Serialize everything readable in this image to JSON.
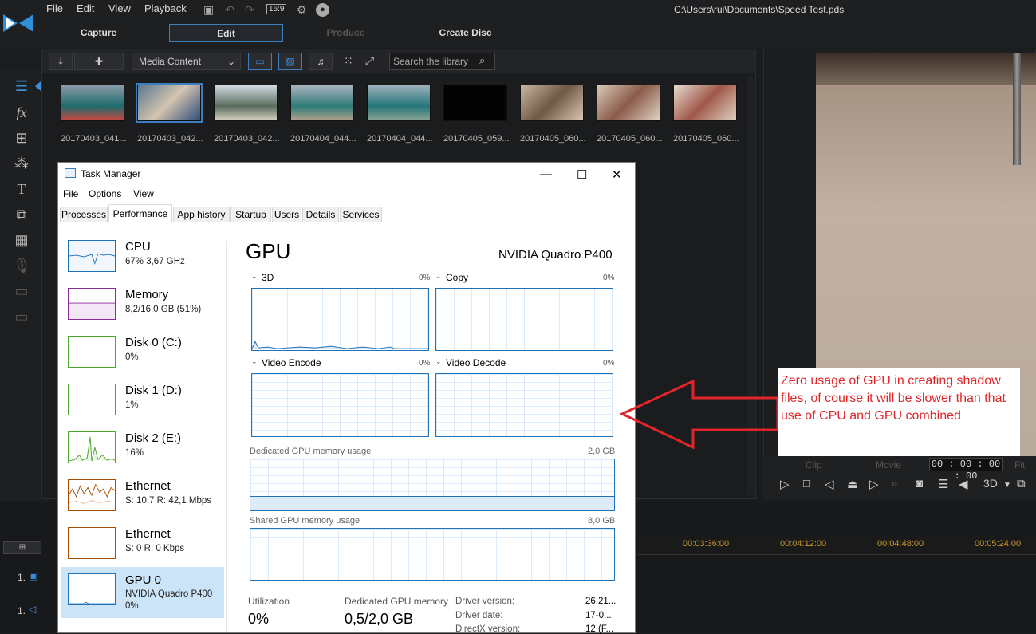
{
  "app": {
    "menu": [
      "File",
      "Edit",
      "View",
      "Playback"
    ],
    "aspect": "16:9",
    "file_path": "C:\\Users\\rui\\Documents\\Speed Test.pds",
    "modes": [
      "Capture",
      "Edit",
      "Produce",
      "Create Disc"
    ]
  },
  "library": {
    "media_select": "Media Content",
    "search_placeholder": "Search the library",
    "thumbs": [
      "20170403_041...",
      "20170403_042...",
      "20170403_042...",
      "20170404_044...",
      "20170404_044...",
      "20170405_059...",
      "20170405_060...",
      "20170405_060...",
      "20170405_060..."
    ]
  },
  "preview": {
    "clip": "Clip",
    "movie": "Movie",
    "timecode": "00 : 00 : 00 : 00",
    "fit": "Fit",
    "mode3d": "3D"
  },
  "timeline": {
    "ticks": [
      "00:03:36:00",
      "00:04:12:00",
      "00:04:48:00",
      "00:05:24:00"
    ],
    "tracks": [
      "1.",
      "1."
    ]
  },
  "taskmanager": {
    "title": "Task Manager",
    "menu": [
      "File",
      "Options",
      "View"
    ],
    "tabs": [
      "Processes",
      "Performance",
      "App history",
      "Startup",
      "Users",
      "Details",
      "Services"
    ],
    "sidebar": [
      {
        "name": "CPU",
        "sub": "67% 3,67 GHz",
        "color": "#1e73b8"
      },
      {
        "name": "Memory",
        "sub": "8,2/16,0 GB (51%)",
        "color": "#8b2a99"
      },
      {
        "name": "Disk 0 (C:)",
        "sub": "0%",
        "color": "#4da62e"
      },
      {
        "name": "Disk 1 (D:)",
        "sub": "1%",
        "color": "#4da62e"
      },
      {
        "name": "Disk 2 (E:)",
        "sub": "16%",
        "color": "#4da62e"
      },
      {
        "name": "Ethernet",
        "sub": "S: 10,7  R: 42,1 Mbps",
        "color": "#a74f01"
      },
      {
        "name": "Ethernet",
        "sub": "S: 0  R: 0 Kbps",
        "color": "#a74f01"
      },
      {
        "name": "GPU 0",
        "sub": "NVIDIA Quadro P400",
        "sub2": "0%",
        "color": "#1e73b8"
      }
    ],
    "gpu": {
      "heading": "GPU",
      "model": "NVIDIA Quadro P400",
      "engines": [
        {
          "name": "3D",
          "pct": "0%"
        },
        {
          "name": "Copy",
          "pct": "0%"
        },
        {
          "name": "Video Encode",
          "pct": "0%"
        },
        {
          "name": "Video Decode",
          "pct": "0%"
        }
      ],
      "dedicated_label": "Dedicated GPU memory usage",
      "dedicated_max": "2,0 GB",
      "shared_label": "Shared GPU memory usage",
      "shared_max": "8,0 GB",
      "utilization_label": "Utilization",
      "utilization": "0%",
      "dedicated_mem_label": "Dedicated GPU memory",
      "dedicated_mem": "0,5/2,0 GB",
      "driver": [
        {
          "k": "Driver version:",
          "v": "26.21..."
        },
        {
          "k": "Driver date:",
          "v": "17-0..."
        },
        {
          "k": "DirectX version:",
          "v": "12 (F..."
        }
      ]
    }
  },
  "annotation": "Zero usage of GPU in creating shadow files, of course it will be slower than that use of CPU and GPU combined"
}
